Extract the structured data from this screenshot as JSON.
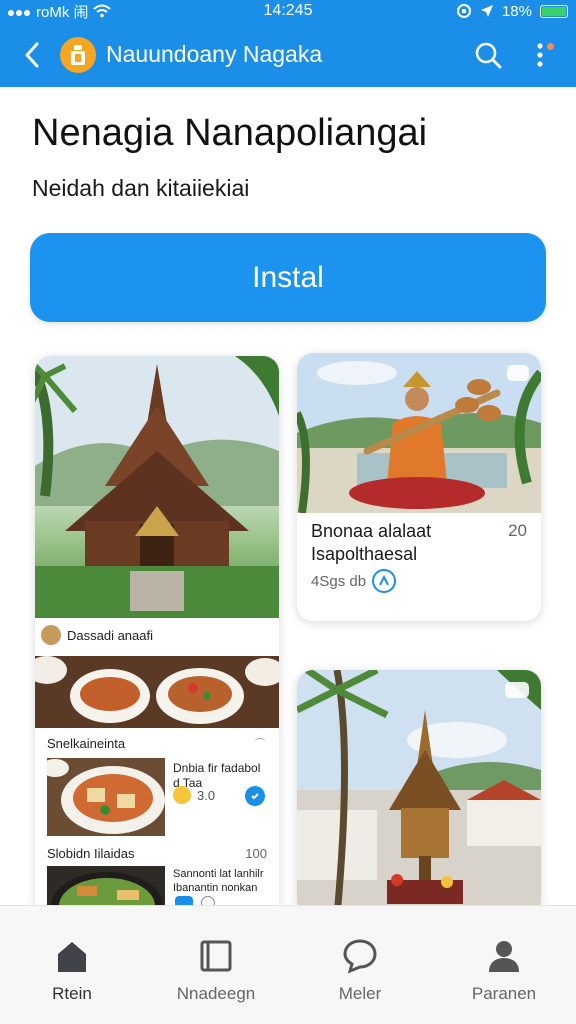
{
  "status": {
    "carrier": "roMk 闹",
    "time": "14:245",
    "battery": "18%"
  },
  "appbar": {
    "title": "Nauundoany Nagaka"
  },
  "page": {
    "heading": "Nenagia Nanapoliangai",
    "subheading": "Neidah dan kitaiiekiai"
  },
  "install_label": "Instal",
  "cards": {
    "performer": {
      "title_line1": "Bnonaa alalaat",
      "title_line2": "Isapolthaesal",
      "meta": "4Sgs db",
      "count": "20"
    },
    "food_header": {
      "label": "Dassadi anaafi"
    },
    "food_section1": {
      "label": "Snelkaineinta"
    },
    "food_item1": {
      "line1": "Dnbia fir fadabol",
      "line2": "d Taa",
      "rating": "3.0"
    },
    "food_section2": {
      "label": "Slobidn Iilaidas",
      "count": "100"
    },
    "food_item2": {
      "line1": "Sannonti lat lanhilr",
      "line2": "Ibanantin nonkan"
    }
  },
  "bottom_nav": [
    {
      "label": "Rtein"
    },
    {
      "label": "Nnadeegn"
    },
    {
      "label": "Meler"
    },
    {
      "label": "Paranen"
    }
  ],
  "colors": {
    "primary": "#1b8fe8",
    "install": "#1c93ee"
  }
}
